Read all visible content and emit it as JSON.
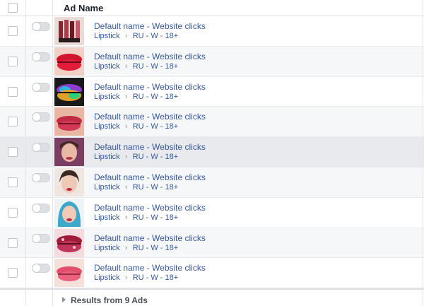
{
  "header": {
    "title": "Ad Name"
  },
  "rows": [
    {
      "name": "Default name - Website clicks",
      "campaign": "Lipstick",
      "adset": "RU - W - 18+",
      "thumb": "lipstick-tubes"
    },
    {
      "name": "Default name - Website clicks",
      "campaign": "Lipstick",
      "adset": "RU - W - 18+",
      "thumb": "red-lips"
    },
    {
      "name": "Default name - Website clicks",
      "campaign": "Lipstick",
      "adset": "RU - W - 18+",
      "thumb": "rainbow-lips"
    },
    {
      "name": "Default name - Website clicks",
      "campaign": "Lipstick",
      "adset": "RU - W - 18+",
      "thumb": "pink-lips"
    },
    {
      "name": "Default name - Website clicks",
      "campaign": "Lipstick",
      "adset": "RU - W - 18+",
      "thumb": "woman-face"
    },
    {
      "name": "Default name - Website clicks",
      "campaign": "Lipstick",
      "adset": "RU - W - 18+",
      "thumb": "woman-face-2"
    },
    {
      "name": "Default name - Website clicks",
      "campaign": "Lipstick",
      "adset": "RU - W - 18+",
      "thumb": "woman-blue-hair"
    },
    {
      "name": "Default name - Website clicks",
      "campaign": "Lipstick",
      "adset": "RU - W - 18+",
      "thumb": "glitter-lips"
    },
    {
      "name": "Default name - Website clicks",
      "campaign": "Lipstick",
      "adset": "RU - W - 18+",
      "thumb": "soft-pink-lips"
    }
  ],
  "footer": {
    "label": "Results from 9 Ads"
  },
  "colors": {
    "link": "#365899",
    "text": "#4b4f56",
    "border": "#dddfe2"
  }
}
